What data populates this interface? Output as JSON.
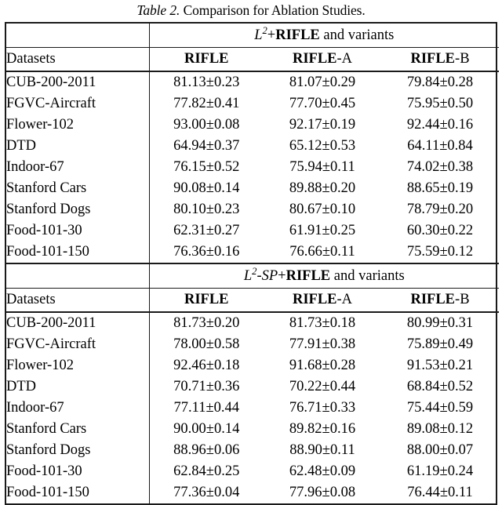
{
  "caption": {
    "label": "Table 2.",
    "text": " Comparison for Ablation Studies."
  },
  "table": {
    "datasets_header": "Datasets",
    "columns": [
      {
        "base": "RIFLE",
        "suffix": ""
      },
      {
        "base": "RIFLE",
        "suffix": "-A"
      },
      {
        "base": "RIFLE",
        "suffix": "-B"
      }
    ],
    "blocks": [
      {
        "group_title": {
          "math": "L",
          "sup": "2",
          "math_tail": "",
          "plus": "+",
          "bold": "RIFLE",
          "tail": " and variants"
        },
        "rows": [
          {
            "dataset": "CUB-200-2011",
            "values": [
              "81.13±0.23",
              "81.07±0.29",
              "79.84±0.28"
            ]
          },
          {
            "dataset": "FGVC-Aircraft",
            "values": [
              "77.82±0.41",
              "77.70±0.45",
              "75.95±0.50"
            ]
          },
          {
            "dataset": "Flower-102",
            "values": [
              "93.00±0.08",
              "92.17±0.19",
              "92.44±0.16"
            ]
          },
          {
            "dataset": "DTD",
            "values": [
              "64.94±0.37",
              "65.12±0.53",
              "64.11±0.84"
            ]
          },
          {
            "dataset": "Indoor-67",
            "values": [
              "76.15±0.52",
              "75.94±0.11",
              "74.02±0.38"
            ]
          },
          {
            "dataset": "Stanford Cars",
            "values": [
              "90.08±0.14",
              "89.88±0.20",
              "88.65±0.19"
            ]
          },
          {
            "dataset": "Stanford Dogs",
            "values": [
              "80.10±0.23",
              "80.67±0.10",
              "78.79±0.20"
            ]
          },
          {
            "dataset": "Food-101-30",
            "values": [
              "62.31±0.27",
              "61.91±0.25",
              "60.30±0.22"
            ]
          },
          {
            "dataset": "Food-101-150",
            "values": [
              "76.36±0.16",
              "76.66±0.11",
              "75.59±0.12"
            ]
          }
        ]
      },
      {
        "group_title": {
          "math": "L",
          "sup": "2",
          "math_tail": "-SP",
          "plus": "+",
          "bold": "RIFLE",
          "tail": " and variants"
        },
        "rows": [
          {
            "dataset": "CUB-200-2011",
            "values": [
              "81.73±0.20",
              "81.73±0.18",
              "80.99±0.31"
            ]
          },
          {
            "dataset": "FGVC-Aircraft",
            "values": [
              "78.00±0.58",
              "77.91±0.38",
              "75.89±0.49"
            ]
          },
          {
            "dataset": "Flower-102",
            "values": [
              "92.46±0.18",
              "91.68±0.28",
              "91.53±0.21"
            ]
          },
          {
            "dataset": "DTD",
            "values": [
              "70.71±0.36",
              "70.22±0.44",
              "68.84±0.52"
            ]
          },
          {
            "dataset": "Indoor-67",
            "values": [
              "77.11±0.44",
              "76.71±0.33",
              "75.44±0.59"
            ]
          },
          {
            "dataset": "Stanford Cars",
            "values": [
              "90.00±0.14",
              "89.82±0.16",
              "89.08±0.12"
            ]
          },
          {
            "dataset": "Stanford Dogs",
            "values": [
              "88.96±0.06",
              "88.90±0.11",
              "88.00±0.07"
            ]
          },
          {
            "dataset": "Food-101-30",
            "values": [
              "62.84±0.25",
              "62.48±0.09",
              "61.19±0.24"
            ]
          },
          {
            "dataset": "Food-101-150",
            "values": [
              "77.36±0.04",
              "77.96±0.08",
              "76.44±0.11"
            ]
          }
        ]
      }
    ]
  },
  "style": {
    "rule_color": "#1a1a1a",
    "text_color": "#000000",
    "background": "#ffffff"
  }
}
